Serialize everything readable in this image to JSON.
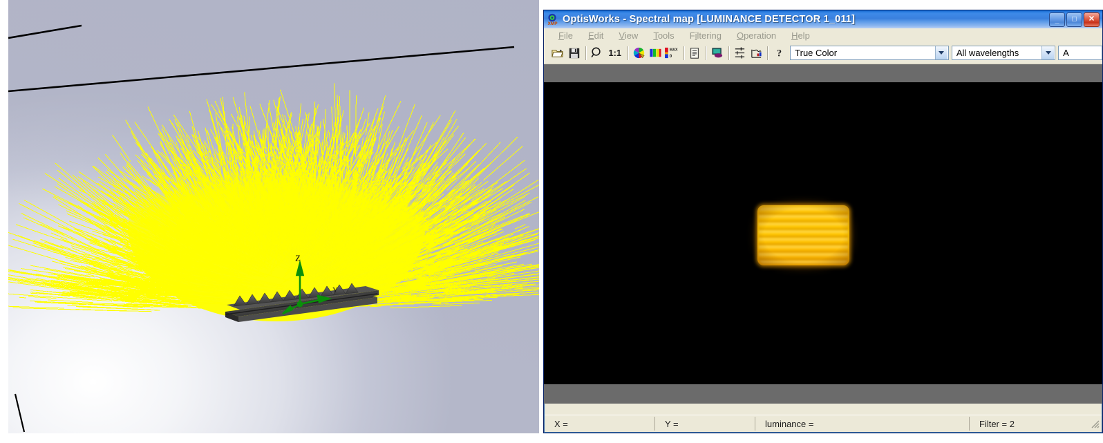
{
  "scene": {
    "name": "raytrace-3d-viewport",
    "description": "3D ray-trace simulation of a linear prismatic LED light guide emitting a yellow fan of rays",
    "ray_color": "#ffff00",
    "background_colors": [
      "#ffffff",
      "#b4b7c9"
    ],
    "axes": [
      {
        "label": "Z",
        "color": "#008000",
        "direction": "up"
      },
      {
        "label": "Y",
        "color": "#008000",
        "direction": "right"
      },
      {
        "label": "X",
        "color": "#008000",
        "direction": "depth"
      }
    ],
    "device_color": "#4a4a4a"
  },
  "window": {
    "title": "OptisWorks - Spectral map [LUMINANCE DETECTOR 1_011]",
    "icon": "optisworks-xmp-icon",
    "controls": [
      {
        "name": "minimize-button",
        "glyph": "_"
      },
      {
        "name": "maximize-button",
        "glyph": "□"
      },
      {
        "name": "close-button",
        "glyph": "✕"
      }
    ]
  },
  "menubar": {
    "items": [
      {
        "label": "File",
        "accel": "F"
      },
      {
        "label": "Edit",
        "accel": "E"
      },
      {
        "label": "View",
        "accel": "V"
      },
      {
        "label": "Tools",
        "accel": "T"
      },
      {
        "label": "Filtering",
        "accel": "i"
      },
      {
        "label": "Operation",
        "accel": "O"
      },
      {
        "label": "Help",
        "accel": "H"
      }
    ]
  },
  "toolbar": {
    "buttons": [
      {
        "name": "open-icon",
        "title": "Open"
      },
      {
        "name": "save-icon",
        "title": "Save"
      },
      {
        "name": "zoom-icon",
        "title": "Zoom"
      },
      {
        "name": "one-to-one-label",
        "title": "1:1",
        "label": "1:1"
      },
      {
        "name": "color-palette-icon",
        "title": "Color palette"
      },
      {
        "name": "rgb-bars-icon",
        "title": "RGB channels"
      },
      {
        "name": "max-min-scale-icon",
        "title": "Max / min scale",
        "max_label": "MAX",
        "min_label": "0"
      },
      {
        "name": "report-icon",
        "title": "Report"
      },
      {
        "name": "display-icon",
        "title": "Display settings"
      },
      {
        "name": "levels-icon",
        "title": "Levels"
      },
      {
        "name": "graph-icon",
        "title": "Graph"
      },
      {
        "name": "help-icon",
        "title": "Help"
      }
    ],
    "combos": [
      {
        "name": "color-mode-select",
        "value": "True Color"
      },
      {
        "name": "wavelength-select",
        "value": "All wavelengths"
      },
      {
        "name": "extra-select",
        "value": "A"
      }
    ]
  },
  "canvas": {
    "name": "spectral-map-canvas",
    "background": "#000000",
    "spot": {
      "name": "luminance-spot",
      "shape": "rounded-rectangle",
      "center_color": "#ffc400",
      "edge_color": "#c88a00",
      "banding": "horizontal-stripes",
      "band_count": 7
    }
  },
  "statusbar": {
    "cells": [
      {
        "name": "status-x",
        "label": "X ="
      },
      {
        "name": "status-y",
        "label": "Y ="
      },
      {
        "name": "status-luminance",
        "label": "luminance ="
      },
      {
        "name": "status-filter",
        "label": "Filter = 2"
      }
    ]
  }
}
